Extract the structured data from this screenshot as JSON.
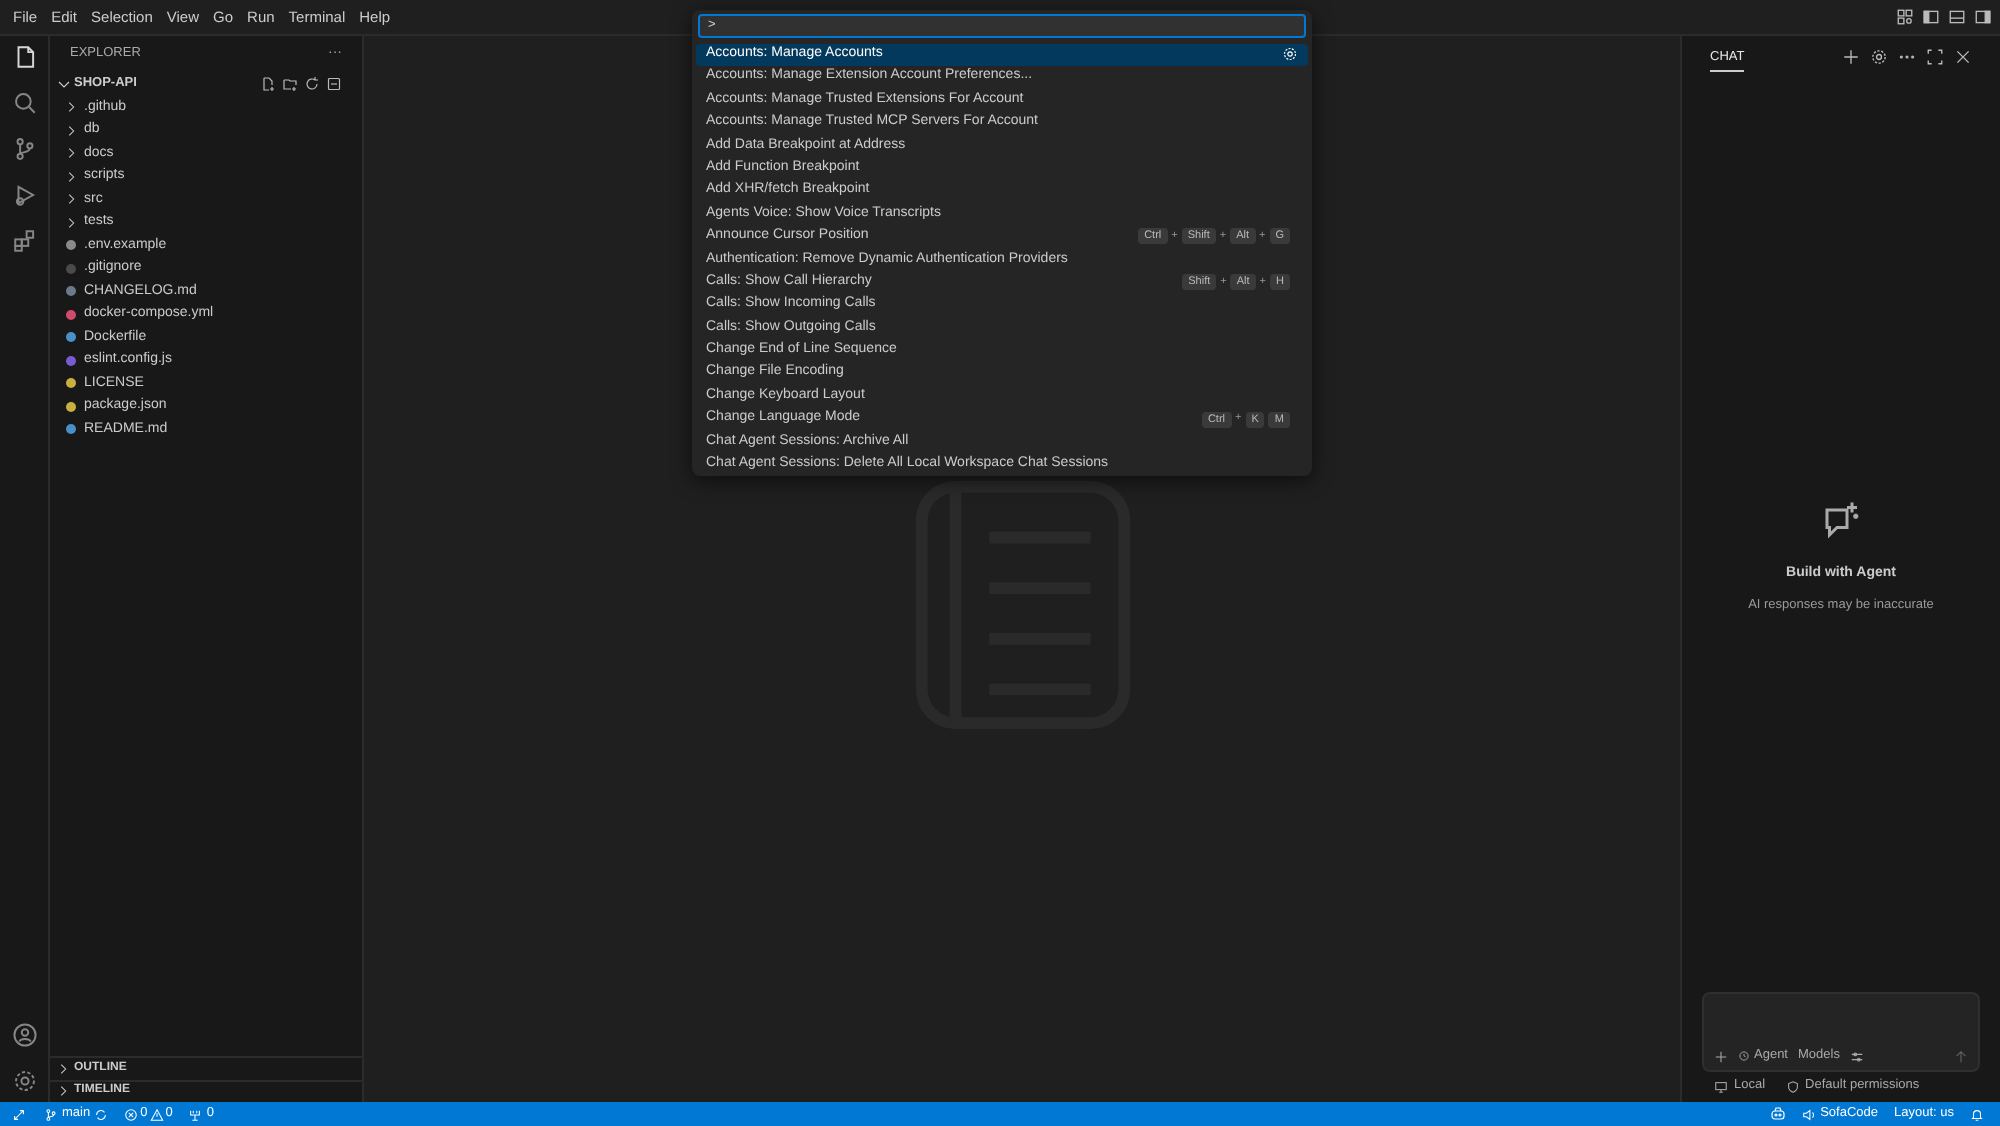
{
  "menu": [
    "File",
    "Edit",
    "Selection",
    "View",
    "Go",
    "Run",
    "Terminal",
    "Help"
  ],
  "explorer": {
    "title": "EXPLORER",
    "more": "···",
    "folder": {
      "name": "SHOP-API",
      "expanded": true
    },
    "items": [
      {
        "kind": "folder",
        "name": ".github",
        "expanded": false
      },
      {
        "kind": "folder",
        "name": "db",
        "expanded": false
      },
      {
        "kind": "folder",
        "name": "docs",
        "expanded": false
      },
      {
        "kind": "folder",
        "name": "scripts",
        "expanded": false
      },
      {
        "kind": "folder",
        "name": "src",
        "expanded": false
      },
      {
        "kind": "folder",
        "name": "tests",
        "expanded": false
      },
      {
        "kind": "file",
        "name": ".env.example",
        "color": "#8a8a8a"
      },
      {
        "kind": "file",
        "name": ".gitignore",
        "color": "#4a4a4a"
      },
      {
        "kind": "file",
        "name": "CHANGELOG.md",
        "color": "#6b7a8a"
      },
      {
        "kind": "file",
        "name": "docker-compose.yml",
        "color": "#d04a6a"
      },
      {
        "kind": "file",
        "name": "Dockerfile",
        "color": "#4a90c8"
      },
      {
        "kind": "file",
        "name": "eslint.config.js",
        "color": "#7a5ad0"
      },
      {
        "kind": "file",
        "name": "LICENSE",
        "color": "#c8b040"
      },
      {
        "kind": "file",
        "name": "package.json",
        "color": "#c8b040"
      },
      {
        "kind": "file",
        "name": "README.md",
        "color": "#4a90c8"
      }
    ],
    "sections": [
      {
        "name": "OUTLINE",
        "expanded": false
      },
      {
        "name": "TIMELINE",
        "expanded": false
      }
    ]
  },
  "palette": {
    "value": ">",
    "items": [
      {
        "label": "Accounts: Manage Accounts",
        "selected": true
      },
      {
        "label": "Accounts: Manage Extension Account Preferences...",
        "selected": false
      },
      {
        "label": "Accounts: Manage Trusted Extensions For Account",
        "selected": false
      },
      {
        "label": "Accounts: Manage Trusted MCP Servers For Account",
        "selected": false
      },
      {
        "label": "Add Data Breakpoint at Address",
        "selected": false
      },
      {
        "label": "Add Function Breakpoint",
        "selected": false
      },
      {
        "label": "Add XHR/fetch Breakpoint",
        "selected": false
      },
      {
        "label": "Agents Voice: Show Voice Transcripts",
        "selected": false
      },
      {
        "label": "Announce Cursor Position",
        "selected": false,
        "keybinding": [
          {
            "kind": "key",
            "text": "Ctrl"
          },
          {
            "kind": "sep",
            "text": "+"
          },
          {
            "kind": "key",
            "text": "Shift"
          },
          {
            "kind": "sep",
            "text": "+"
          },
          {
            "kind": "key",
            "text": "Alt"
          },
          {
            "kind": "sep",
            "text": "+"
          },
          {
            "kind": "key",
            "text": "G"
          }
        ]
      },
      {
        "label": "Authentication: Remove Dynamic Authentication Providers",
        "selected": false
      },
      {
        "label": "Calls: Show Call Hierarchy",
        "selected": false,
        "keybinding": [
          {
            "kind": "key",
            "text": "Shift"
          },
          {
            "kind": "sep",
            "text": "+"
          },
          {
            "kind": "key",
            "text": "Alt"
          },
          {
            "kind": "sep",
            "text": "+"
          },
          {
            "kind": "key",
            "text": "H"
          }
        ]
      },
      {
        "label": "Calls: Show Incoming Calls",
        "selected": false
      },
      {
        "label": "Calls: Show Outgoing Calls",
        "selected": false
      },
      {
        "label": "Change End of Line Sequence",
        "selected": false
      },
      {
        "label": "Change File Encoding",
        "selected": false
      },
      {
        "label": "Change Keyboard Layout",
        "selected": false
      },
      {
        "label": "Change Language Mode",
        "selected": false,
        "keybinding": [
          {
            "kind": "key",
            "text": "Ctrl"
          },
          {
            "kind": "sep",
            "text": "+"
          },
          {
            "kind": "key",
            "text": "K"
          },
          {
            "kind": "key",
            "text": "M"
          }
        ]
      },
      {
        "label": "Chat Agent Sessions: Archive All",
        "selected": false
      },
      {
        "label": "Chat Agent Sessions: Delete All Local Workspace Chat Sessions",
        "selected": false
      }
    ]
  },
  "chat": {
    "tab": {
      "label": "CHAT",
      "selected": true
    },
    "heading": "Build with Agent",
    "subtitle": "AI responses may be inaccurate",
    "mode": "Agent",
    "models": "Models",
    "location": "Local",
    "permissions": "Default permissions"
  },
  "status_bar": {
    "branch": "main",
    "errors": "0",
    "warnings": "0",
    "ports": "0",
    "sofacode": "SofaCode",
    "layout": "Layout: us"
  }
}
